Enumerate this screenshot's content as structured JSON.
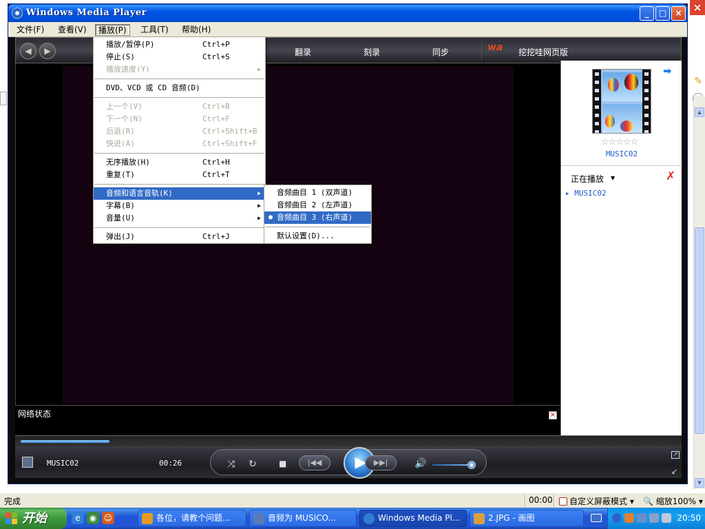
{
  "window": {
    "title": "Windows Media Player",
    "controls": {
      "minimize": "_",
      "maximize": "□",
      "close": "×"
    }
  },
  "menubar": [
    {
      "label": "文件(F)"
    },
    {
      "label": "查看(V)"
    },
    {
      "label": "播放(P)"
    },
    {
      "label": "工具(T)"
    },
    {
      "label": "帮助(H)"
    }
  ],
  "toolbar": {
    "tabs": [
      "翻录",
      "刻录",
      "同步"
    ],
    "online_store": "挖挖哇网页版",
    "logo": "wa"
  },
  "play_menu": {
    "items": [
      {
        "label": "播放/暂停(P)",
        "key": "Ctrl+P"
      },
      {
        "label": "停止(S)",
        "key": "Ctrl+S"
      },
      {
        "label": "播放速度(Y)",
        "key": ""
      },
      {
        "label": "DVD、VCD 或 CD 音频(D)",
        "key": ""
      },
      {
        "label": "上一个(V)",
        "key": "Ctrl+B"
      },
      {
        "label": "下一个(N)",
        "key": "Ctrl+F"
      },
      {
        "label": "后退(R)",
        "key": "Ctrl+Shift+B"
      },
      {
        "label": "快进(A)",
        "key": "Ctrl+Shift+F"
      },
      {
        "label": "无序播放(H)",
        "key": "Ctrl+H"
      },
      {
        "label": "重复(T)",
        "key": "Ctrl+T"
      },
      {
        "label": "音频和语言音轨(K)",
        "key": ""
      },
      {
        "label": "字幕(B)",
        "key": ""
      },
      {
        "label": "音量(U)",
        "key": ""
      },
      {
        "label": "弹出(J)",
        "key": "Ctrl+J"
      }
    ]
  },
  "audio_submenu": {
    "items": [
      {
        "label": "音频曲目 1 (双声道)"
      },
      {
        "label": "音频曲目 2 (左声道)"
      },
      {
        "label": "音频曲目 3 (右声道)",
        "selected": true
      },
      {
        "label": "默认设置(D)..."
      }
    ]
  },
  "network": {
    "label": "网络状态"
  },
  "playlist": {
    "song": "MUSIC02",
    "rating_stars": "☆☆☆☆☆",
    "now_playing": "正在播放",
    "items": [
      "MUSIC02"
    ]
  },
  "player": {
    "song": "MUSIC02",
    "time": "00:26",
    "seek_progress": 0.135,
    "volume": 0.92
  },
  "statusbar": {
    "text": "完成",
    "time": "00:00",
    "mode": "自定义屏蔽模式",
    "zoom": "缩放100%"
  },
  "taskbar": {
    "start": "开始",
    "tasks": [
      {
        "label": "各位，请教个问题..."
      },
      {
        "label": "音频为    MUSICO..."
      },
      {
        "label": "Windows Media Pl..."
      },
      {
        "label": "2.JPG - 画图"
      }
    ],
    "clock": "20:50"
  },
  "colors": {
    "menu_highlight": "#316ac5",
    "title_blue": "#0055e5",
    "playlist_link": "#1d5cc9"
  }
}
